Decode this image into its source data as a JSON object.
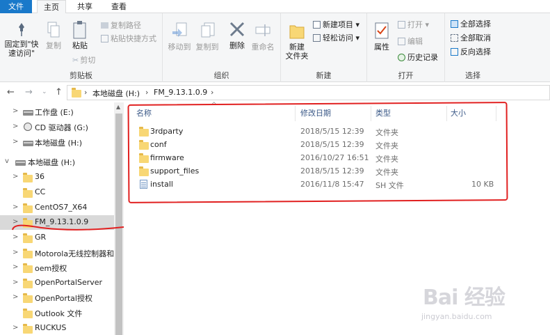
{
  "tabs": {
    "file": "文件",
    "home": "主页",
    "share": "共享",
    "view": "查看"
  },
  "ribbon": {
    "clipboard": {
      "label": "剪贴板",
      "pin_line1": "固定到\"快",
      "pin_line2": "速访问\"",
      "copy": "复制",
      "paste": "粘贴",
      "copy_path": "复制路径",
      "paste_shortcut": "粘贴快捷方式",
      "cut": "剪切"
    },
    "organize": {
      "label": "组织",
      "move_to": "移动到",
      "copy_to": "复制到",
      "delete": "删除",
      "rename": "重命名"
    },
    "new": {
      "label": "新建",
      "new_folder_line1": "新建",
      "new_folder_line2": "文件夹",
      "new_item": "新建项目 ▾",
      "easy_access": "轻松访问 ▾"
    },
    "open": {
      "label": "打开",
      "properties": "属性",
      "open": "打开 ▾",
      "edit": "编辑",
      "history": "历史记录"
    },
    "select": {
      "label": "选择",
      "select_all": "全部选择",
      "select_none": "全部取消",
      "invert": "反向选择"
    }
  },
  "address": {
    "crumbs": [
      "本地磁盘 (H:)",
      "FM_9.13.1.0.9"
    ]
  },
  "tree": [
    {
      "label": "工作盘 (E:)",
      "type": "drive",
      "chevron": ">"
    },
    {
      "label": "CD 驱动器 (G:)",
      "type": "cd",
      "chevron": ">"
    },
    {
      "label": "本地磁盘 (H:)",
      "type": "drive",
      "chevron": ">"
    },
    {
      "label": "本地磁盘 (H:)",
      "type": "drive",
      "chevron": "v"
    },
    {
      "label": "36",
      "type": "folder",
      "chevron": ">"
    },
    {
      "label": "CC",
      "type": "folder",
      "chevron": ""
    },
    {
      "label": "CentOS7_X64",
      "type": "folder",
      "chevron": ">"
    },
    {
      "label": "FM_9.13.1.0.9",
      "type": "folder",
      "chevron": ">"
    },
    {
      "label": "GR",
      "type": "folder",
      "chevron": ">"
    },
    {
      "label": "Motorola无线控制器和",
      "type": "folder",
      "chevron": ">"
    },
    {
      "label": "oem授权",
      "type": "folder",
      "chevron": ">"
    },
    {
      "label": "OpenPortalServer",
      "type": "folder",
      "chevron": ">"
    },
    {
      "label": "OpenPortal授权",
      "type": "folder",
      "chevron": ">"
    },
    {
      "label": "Outlook 文件",
      "type": "folder",
      "chevron": ""
    },
    {
      "label": "RUCKUS",
      "type": "folder",
      "chevron": ">"
    }
  ],
  "columns": {
    "name": "名称",
    "modified": "修改日期",
    "type": "类型",
    "size": "大小"
  },
  "files": [
    {
      "name": "3rdparty",
      "modified": "2018/5/15 12:39",
      "type": "文件夹",
      "size": "",
      "icon": "folder"
    },
    {
      "name": "conf",
      "modified": "2018/5/15 12:39",
      "type": "文件夹",
      "size": "",
      "icon": "folder"
    },
    {
      "name": "firmware",
      "modified": "2016/10/27 16:51",
      "type": "文件夹",
      "size": "",
      "icon": "folder"
    },
    {
      "name": "support_files",
      "modified": "2018/5/15 12:39",
      "type": "文件夹",
      "size": "",
      "icon": "folder"
    },
    {
      "name": "install",
      "modified": "2016/11/8 15:47",
      "type": "SH 文件",
      "size": "10 KB",
      "icon": "sh-file"
    }
  ],
  "watermark": {
    "main": "Bai 经验",
    "sub": "jingyan.baidu.com"
  },
  "colors": {
    "accent": "#1979ca",
    "annotation": "#e12020",
    "folder": "#f8d775"
  }
}
